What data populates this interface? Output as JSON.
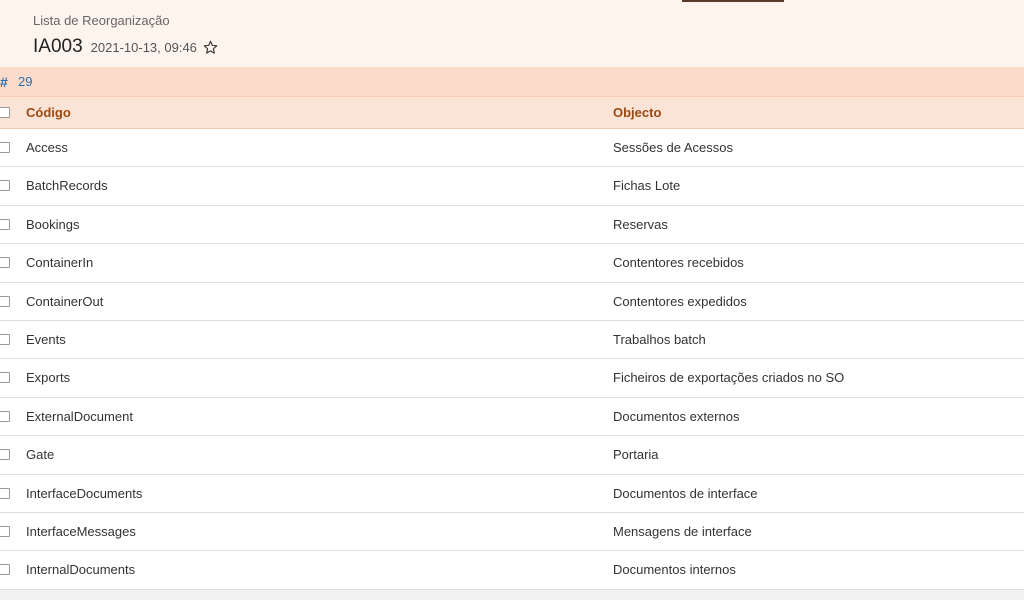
{
  "header": {
    "breadcrumb": "Lista de Reorganização",
    "record_id": "IA003",
    "timestamp": "2021-10-13, 09:46",
    "favorite_icon": "star-outline-icon"
  },
  "countbar": {
    "icon": "hash-icon",
    "count": "29"
  },
  "table": {
    "columns": [
      "Código",
      "Objecto"
    ],
    "rows": [
      {
        "codigo": "Access",
        "objecto": "Sessões de Acessos"
      },
      {
        "codigo": "BatchRecords",
        "objecto": "Fichas Lote"
      },
      {
        "codigo": "Bookings",
        "objecto": "Reservas"
      },
      {
        "codigo": "ContainerIn",
        "objecto": "Contentores recebidos"
      },
      {
        "codigo": "ContainerOut",
        "objecto": "Contentores expedidos"
      },
      {
        "codigo": "Events",
        "objecto": "Trabalhos batch"
      },
      {
        "codigo": "Exports",
        "objecto": "Ficheiros de exportações criados no SO"
      },
      {
        "codigo": "ExternalDocument",
        "objecto": "Documentos externos"
      },
      {
        "codigo": "Gate",
        "objecto": "Portaria"
      },
      {
        "codigo": "InterfaceDocuments",
        "objecto": "Documentos de interface"
      },
      {
        "codigo": "InterfaceMessages",
        "objecto": "Mensagens de interface"
      },
      {
        "codigo": "InternalDocuments",
        "objecto": "Documentos internos"
      }
    ]
  },
  "colors": {
    "header_bg": "#fdf4ee",
    "countbar_bg": "#fbdccb",
    "thead_bg": "#fbe3d5",
    "thead_text": "#9a4a14",
    "accent_blue": "#2a6fb0"
  }
}
